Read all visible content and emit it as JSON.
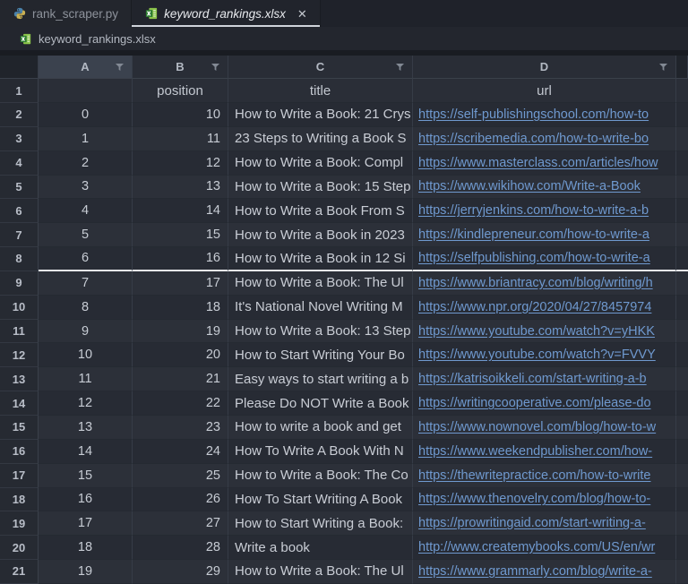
{
  "tabs": [
    {
      "label": "rank_scraper.py",
      "icon": "python-file-icon",
      "active": false
    },
    {
      "label": "keyword_rankings.xlsx",
      "icon": "excel-file-icon",
      "active": true,
      "close_glyph": "✕"
    }
  ],
  "breadcrumb": {
    "label": "keyword_rankings.xlsx",
    "icon": "excel-file-icon"
  },
  "colors": {
    "link": "#6f99cf",
    "active_tab_underline": "#cfd3da",
    "selection_line": "#e8eaed",
    "excel_green": "#3e8e41",
    "python_blue": "#4a82ab",
    "python_yellow": "#c9b052"
  },
  "sheet": {
    "col_headers": [
      {
        "letter": "A",
        "filter": "funnel"
      },
      {
        "letter": "B",
        "filter": "funnel"
      },
      {
        "letter": "C",
        "filter": "funnel"
      },
      {
        "letter": "D",
        "filter": "funnel"
      }
    ],
    "field_row": {
      "num": "1",
      "a": "",
      "b": "position",
      "c": "title",
      "d": "url"
    },
    "selection_line_below_row": "8",
    "rows": [
      {
        "num": "2",
        "a": "0",
        "b": "10",
        "c": "How to Write a Book: 21 Crys",
        "d": "https://self-publishingschool.com/how-to"
      },
      {
        "num": "3",
        "a": "1",
        "b": "11",
        "c": "23 Steps to Writing a Book S",
        "d": "https://scribemedia.com/how-to-write-bo"
      },
      {
        "num": "4",
        "a": "2",
        "b": "12",
        "c": "How to Write a Book: Compl",
        "d": "https://www.masterclass.com/articles/how"
      },
      {
        "num": "5",
        "a": "3",
        "b": "13",
        "c": "How to Write a Book: 15 Step",
        "d": "https://www.wikihow.com/Write-a-Book"
      },
      {
        "num": "6",
        "a": "4",
        "b": "14",
        "c": "How to Write a Book From S",
        "d": "https://jerryjenkins.com/how-to-write-a-b"
      },
      {
        "num": "7",
        "a": "5",
        "b": "15",
        "c": "How to Write a Book in 2023",
        "d": "https://kindlepreneur.com/how-to-write-a"
      },
      {
        "num": "8",
        "a": "6",
        "b": "16",
        "c": "How to Write a Book in 12 Si",
        "d": "https://selfpublishing.com/how-to-write-a"
      },
      {
        "num": "9",
        "a": "7",
        "b": "17",
        "c": "How to Write a Book: The Ul",
        "d": "https://www.briantracy.com/blog/writing/h"
      },
      {
        "num": "10",
        "a": "8",
        "b": "18",
        "c": "It's National Novel Writing M",
        "d": "https://www.npr.org/2020/04/27/8457974"
      },
      {
        "num": "11",
        "a": "9",
        "b": "19",
        "c": "How to Write a Book: 13 Step",
        "d": "https://www.youtube.com/watch?v=yHKK"
      },
      {
        "num": "12",
        "a": "10",
        "b": "20",
        "c": "How to Start Writing Your Bo",
        "d": "https://www.youtube.com/watch?v=FVVY"
      },
      {
        "num": "13",
        "a": "11",
        "b": "21",
        "c": "Easy ways to start writing a b",
        "d": "https://katrisoikkeli.com/start-writing-a-b"
      },
      {
        "num": "14",
        "a": "12",
        "b": "22",
        "c": "Please Do NOT Write a Book",
        "d": "https://writingcooperative.com/please-do"
      },
      {
        "num": "15",
        "a": "13",
        "b": "23",
        "c": "How to write a book and get",
        "d": "https://www.nownovel.com/blog/how-to-w"
      },
      {
        "num": "16",
        "a": "14",
        "b": "24",
        "c": "How To Write A Book With N",
        "d": "https://www.weekendpublisher.com/how-"
      },
      {
        "num": "17",
        "a": "15",
        "b": "25",
        "c": "How to Write a Book: The Co",
        "d": "https://thewritepractice.com/how-to-write"
      },
      {
        "num": "18",
        "a": "16",
        "b": "26",
        "c": "How To Start Writing A Book",
        "d": "https://www.thenovelry.com/blog/how-to-"
      },
      {
        "num": "19",
        "a": "17",
        "b": "27",
        "c": "How to Start Writing a Book:",
        "d": "https://prowritingaid.com/start-writing-a-"
      },
      {
        "num": "20",
        "a": "18",
        "b": "28",
        "c": "Write a book",
        "d": "http://www.createmybooks.com/US/en/wr"
      },
      {
        "num": "21",
        "a": "19",
        "b": "29",
        "c": "How to Write a Book: The Ul",
        "d": "https://www.grammarly.com/blog/write-a-"
      }
    ]
  }
}
